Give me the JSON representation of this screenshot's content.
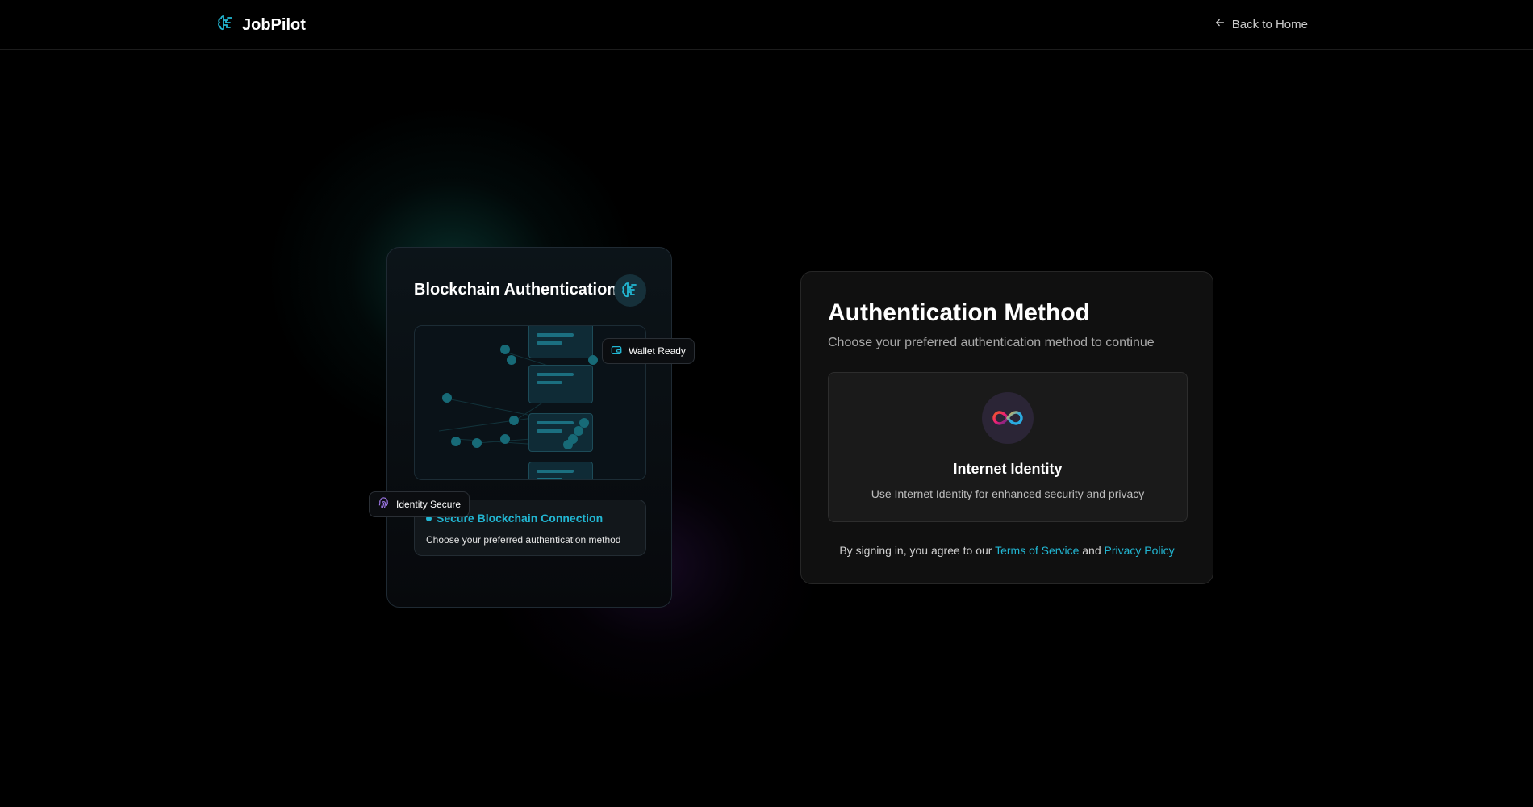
{
  "header": {
    "brand": "JobPilot",
    "back_label": "Back to Home"
  },
  "illustration": {
    "title": "Blockchain Authentication",
    "wallet_badge": "Wallet Ready",
    "identity_badge": "Identity Secure",
    "status_title": "Secure Blockchain Connection",
    "status_text": "Choose your preferred authentication method"
  },
  "auth": {
    "title": "Authentication Method",
    "subtitle": "Choose your preferred authentication method to continue",
    "option_title": "Internet Identity",
    "option_desc": "Use Internet Identity for enhanced security and privacy",
    "terms_prefix": "By signing in, you agree to our",
    "terms_link": "Terms of Service",
    "terms_and": "and",
    "privacy_link": "Privacy Policy"
  },
  "colors": {
    "accent": "#22b6d2",
    "background": "#000000",
    "card": "#101010"
  },
  "icons": [
    "brain-logo-icon",
    "arrow-left-icon",
    "wallet-icon",
    "fingerprint-icon",
    "infinity-icon"
  ]
}
